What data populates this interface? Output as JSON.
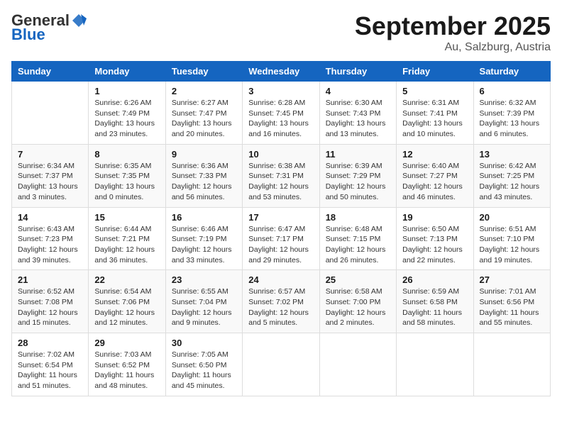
{
  "header": {
    "logo_line1": "General",
    "logo_line2": "Blue",
    "month": "September 2025",
    "location": "Au, Salzburg, Austria"
  },
  "weekdays": [
    "Sunday",
    "Monday",
    "Tuesday",
    "Wednesday",
    "Thursday",
    "Friday",
    "Saturday"
  ],
  "weeks": [
    [
      {
        "day": "",
        "info": ""
      },
      {
        "day": "1",
        "info": "Sunrise: 6:26 AM\nSunset: 7:49 PM\nDaylight: 13 hours\nand 23 minutes."
      },
      {
        "day": "2",
        "info": "Sunrise: 6:27 AM\nSunset: 7:47 PM\nDaylight: 13 hours\nand 20 minutes."
      },
      {
        "day": "3",
        "info": "Sunrise: 6:28 AM\nSunset: 7:45 PM\nDaylight: 13 hours\nand 16 minutes."
      },
      {
        "day": "4",
        "info": "Sunrise: 6:30 AM\nSunset: 7:43 PM\nDaylight: 13 hours\nand 13 minutes."
      },
      {
        "day": "5",
        "info": "Sunrise: 6:31 AM\nSunset: 7:41 PM\nDaylight: 13 hours\nand 10 minutes."
      },
      {
        "day": "6",
        "info": "Sunrise: 6:32 AM\nSunset: 7:39 PM\nDaylight: 13 hours\nand 6 minutes."
      }
    ],
    [
      {
        "day": "7",
        "info": "Sunrise: 6:34 AM\nSunset: 7:37 PM\nDaylight: 13 hours\nand 3 minutes."
      },
      {
        "day": "8",
        "info": "Sunrise: 6:35 AM\nSunset: 7:35 PM\nDaylight: 13 hours\nand 0 minutes."
      },
      {
        "day": "9",
        "info": "Sunrise: 6:36 AM\nSunset: 7:33 PM\nDaylight: 12 hours\nand 56 minutes."
      },
      {
        "day": "10",
        "info": "Sunrise: 6:38 AM\nSunset: 7:31 PM\nDaylight: 12 hours\nand 53 minutes."
      },
      {
        "day": "11",
        "info": "Sunrise: 6:39 AM\nSunset: 7:29 PM\nDaylight: 12 hours\nand 50 minutes."
      },
      {
        "day": "12",
        "info": "Sunrise: 6:40 AM\nSunset: 7:27 PM\nDaylight: 12 hours\nand 46 minutes."
      },
      {
        "day": "13",
        "info": "Sunrise: 6:42 AM\nSunset: 7:25 PM\nDaylight: 12 hours\nand 43 minutes."
      }
    ],
    [
      {
        "day": "14",
        "info": "Sunrise: 6:43 AM\nSunset: 7:23 PM\nDaylight: 12 hours\nand 39 minutes."
      },
      {
        "day": "15",
        "info": "Sunrise: 6:44 AM\nSunset: 7:21 PM\nDaylight: 12 hours\nand 36 minutes."
      },
      {
        "day": "16",
        "info": "Sunrise: 6:46 AM\nSunset: 7:19 PM\nDaylight: 12 hours\nand 33 minutes."
      },
      {
        "day": "17",
        "info": "Sunrise: 6:47 AM\nSunset: 7:17 PM\nDaylight: 12 hours\nand 29 minutes."
      },
      {
        "day": "18",
        "info": "Sunrise: 6:48 AM\nSunset: 7:15 PM\nDaylight: 12 hours\nand 26 minutes."
      },
      {
        "day": "19",
        "info": "Sunrise: 6:50 AM\nSunset: 7:13 PM\nDaylight: 12 hours\nand 22 minutes."
      },
      {
        "day": "20",
        "info": "Sunrise: 6:51 AM\nSunset: 7:10 PM\nDaylight: 12 hours\nand 19 minutes."
      }
    ],
    [
      {
        "day": "21",
        "info": "Sunrise: 6:52 AM\nSunset: 7:08 PM\nDaylight: 12 hours\nand 15 minutes."
      },
      {
        "day": "22",
        "info": "Sunrise: 6:54 AM\nSunset: 7:06 PM\nDaylight: 12 hours\nand 12 minutes."
      },
      {
        "day": "23",
        "info": "Sunrise: 6:55 AM\nSunset: 7:04 PM\nDaylight: 12 hours\nand 9 minutes."
      },
      {
        "day": "24",
        "info": "Sunrise: 6:57 AM\nSunset: 7:02 PM\nDaylight: 12 hours\nand 5 minutes."
      },
      {
        "day": "25",
        "info": "Sunrise: 6:58 AM\nSunset: 7:00 PM\nDaylight: 12 hours\nand 2 minutes."
      },
      {
        "day": "26",
        "info": "Sunrise: 6:59 AM\nSunset: 6:58 PM\nDaylight: 11 hours\nand 58 minutes."
      },
      {
        "day": "27",
        "info": "Sunrise: 7:01 AM\nSunset: 6:56 PM\nDaylight: 11 hours\nand 55 minutes."
      }
    ],
    [
      {
        "day": "28",
        "info": "Sunrise: 7:02 AM\nSunset: 6:54 PM\nDaylight: 11 hours\nand 51 minutes."
      },
      {
        "day": "29",
        "info": "Sunrise: 7:03 AM\nSunset: 6:52 PM\nDaylight: 11 hours\nand 48 minutes."
      },
      {
        "day": "30",
        "info": "Sunrise: 7:05 AM\nSunset: 6:50 PM\nDaylight: 11 hours\nand 45 minutes."
      },
      {
        "day": "",
        "info": ""
      },
      {
        "day": "",
        "info": ""
      },
      {
        "day": "",
        "info": ""
      },
      {
        "day": "",
        "info": ""
      }
    ]
  ]
}
